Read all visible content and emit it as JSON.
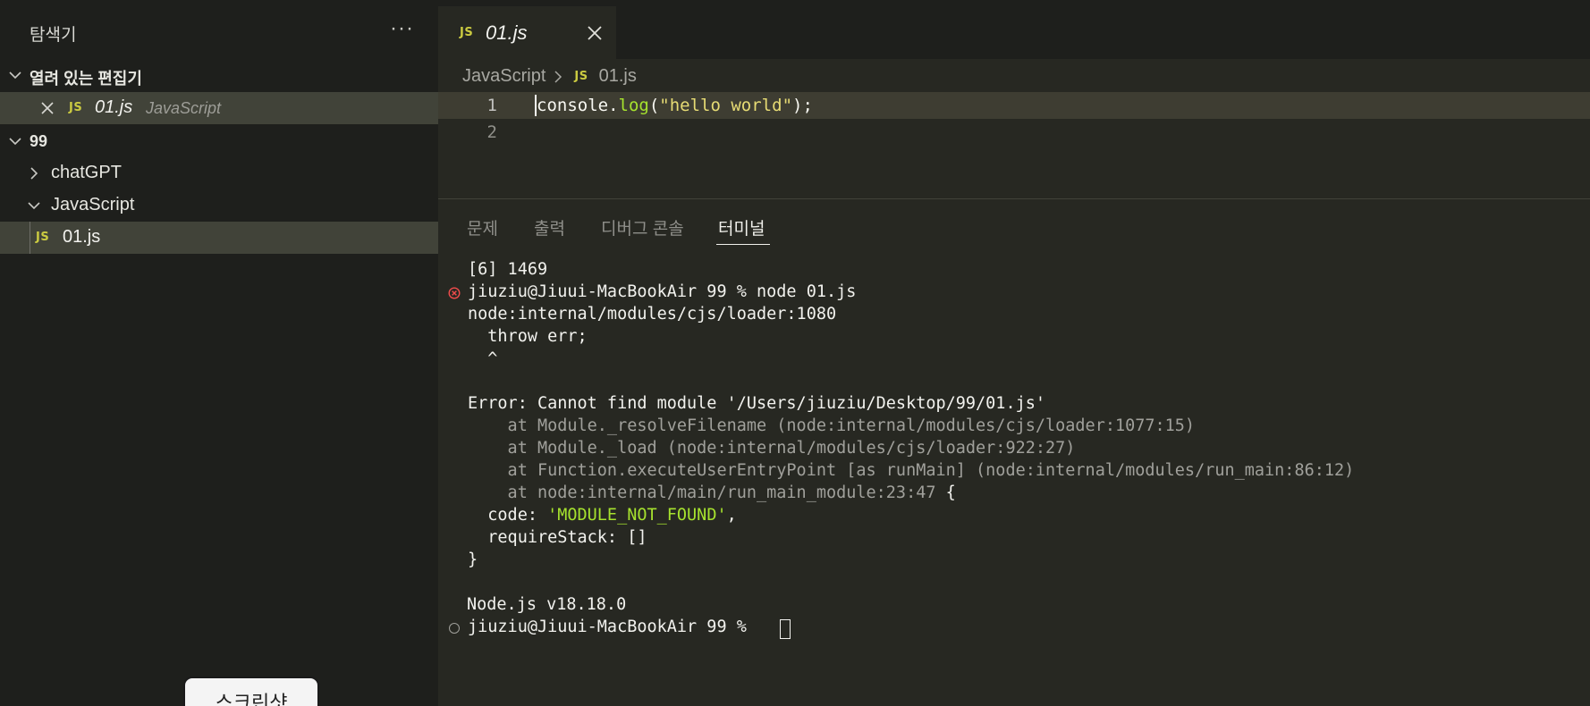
{
  "sidebar": {
    "title": "탐색기",
    "more_label": "···",
    "open_editors": {
      "title": "열려 있는 편집기",
      "items": [
        {
          "badge": "JS",
          "name": "01.js",
          "description": "JavaScript"
        }
      ]
    },
    "workspace": {
      "title": "99",
      "tree": [
        {
          "label": "chatGPT",
          "expanded": false
        },
        {
          "label": "JavaScript",
          "expanded": true
        },
        {
          "badge": "JS",
          "label": "01.js",
          "selected": true
        }
      ]
    }
  },
  "overlay_button": {
    "label": "스크린샷"
  },
  "editor": {
    "tab": {
      "badge": "JS",
      "name": "01.js"
    },
    "breadcrumb": {
      "folder": "JavaScript",
      "badge": "JS",
      "file": "01.js"
    },
    "lines": [
      {
        "number": "1",
        "tokens": [
          "console.",
          "log",
          "(",
          "\"hello world\"",
          ");"
        ]
      },
      {
        "number": "2",
        "tokens": []
      }
    ]
  },
  "panel": {
    "tabs": [
      "문제",
      "출력",
      "디버그 콘솔",
      "터미널"
    ],
    "active_tab": "터미널"
  },
  "terminal": {
    "lines": [
      "[6] 1469",
      "jiuziu@Jiuui-MacBookAir 99 % node 01.js",
      "node:internal/modules/cjs/loader:1080",
      "  throw err;",
      "  ^",
      "Error: Cannot find module '/Users/jiuziu/Desktop/99/01.js'",
      "    at Module._resolveFilename (node:internal/modules/cjs/loader:1077:15)",
      "    at Module._load (node:internal/modules/cjs/loader:922:27)",
      "    at Function.executeUserEntryPoint [as runMain] (node:internal/modules/run_main:86:12)",
      "    at node:internal/main/run_main_module:23:47",
      " {",
      "  code: ",
      "'MODULE_NOT_FOUND'",
      ",",
      "  requireStack: []",
      "}",
      "Node.js v18.18.0",
      "jiuziu@Jiuui-MacBookAir 99 % "
    ]
  },
  "colors": {
    "background": "#272822",
    "sidebar": "#1e1f1c",
    "selection": "#414339",
    "js_badge": "#cbcb41",
    "function": "#a6e22e",
    "string": "#e6db74",
    "error": "#f14c4c"
  }
}
